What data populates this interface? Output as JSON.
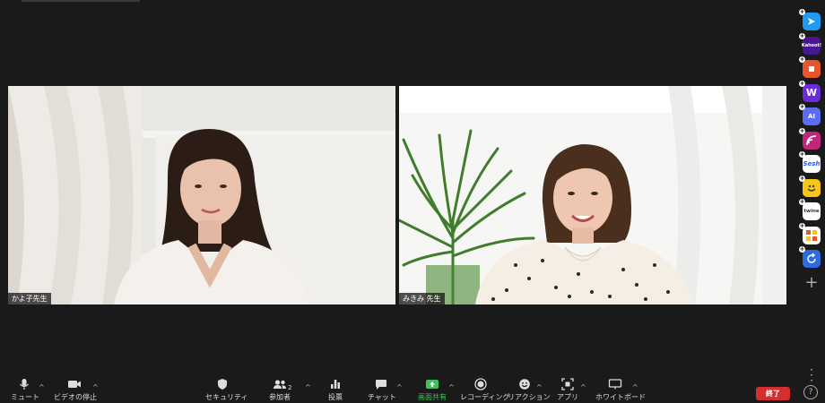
{
  "participants": [
    {
      "name": "かよ子先生"
    },
    {
      "name": "みきみ 先生"
    }
  ],
  "apps": [
    {
      "icon": "arrow-app-icon",
      "text": "",
      "color": "#1e9bf0"
    },
    {
      "icon": "kahoot-icon",
      "text": "Kahoot!",
      "color": "#46178f"
    },
    {
      "icon": "orange-app-icon",
      "text": "",
      "color": "#e8542b"
    },
    {
      "icon": "wooclap-icon",
      "text": "W",
      "color": "#6c2bd9"
    },
    {
      "icon": "ai-app-icon",
      "text": "AI",
      "color": "#5b6cf0"
    },
    {
      "icon": "wave-app-icon",
      "text": "",
      "color": "#c1267a"
    },
    {
      "icon": "sesh-icon",
      "text": "Sesh",
      "color": "#ffffff"
    },
    {
      "icon": "smiley-app-icon",
      "text": "",
      "color": "#f5c518"
    },
    {
      "icon": "twine-icon",
      "text": "twine",
      "color": "#ffffff"
    },
    {
      "icon": "grid-app-icon",
      "text": "",
      "color": "#ffffff"
    },
    {
      "icon": "sync-app-icon",
      "text": "",
      "color": "#2d6cdf"
    }
  ],
  "toolbar": {
    "mute": "ミュート",
    "video": "ビデオの停止",
    "security": "セキュリティ",
    "participants": "参加者",
    "participants_count": "2",
    "polls": "投票",
    "chat": "チャット",
    "share": "画面共有",
    "record": "レコーディング",
    "reactions": "リアクション",
    "apps": "アプリ",
    "whiteboard": "ホワイトボード"
  },
  "end_button": "終了",
  "colors": {
    "background": "#1a1a1a",
    "share_green": "#3ec35a",
    "end_red": "#d32f2f"
  }
}
